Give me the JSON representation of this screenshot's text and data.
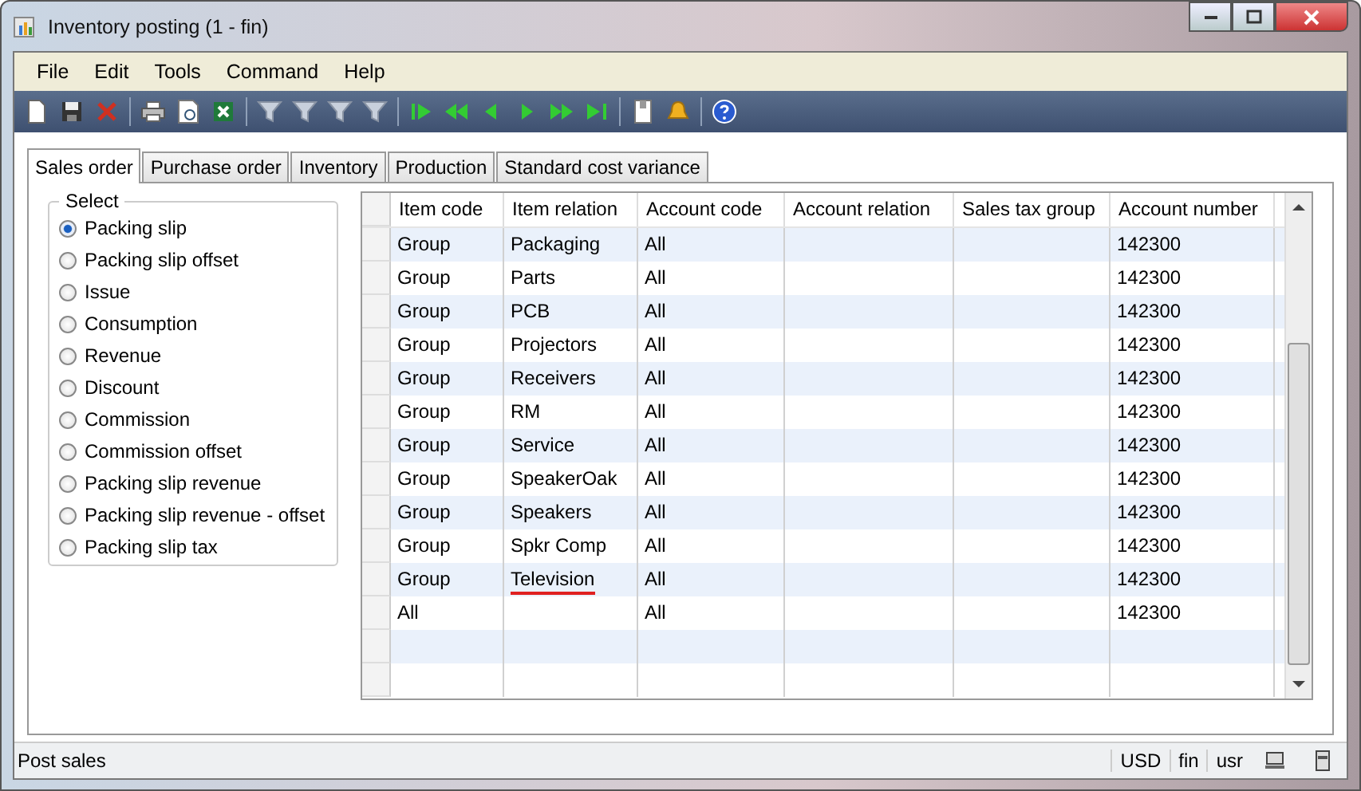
{
  "window": {
    "title": "Inventory posting (1 - fin)"
  },
  "menu": [
    "File",
    "Edit",
    "Tools",
    "Command",
    "Help"
  ],
  "toolbar": [
    {
      "kind": "new"
    },
    {
      "kind": "save"
    },
    {
      "kind": "delete"
    },
    {
      "kind": "sep"
    },
    {
      "kind": "print"
    },
    {
      "kind": "preview"
    },
    {
      "kind": "excel"
    },
    {
      "kind": "sep"
    },
    {
      "kind": "filter"
    },
    {
      "kind": "filter"
    },
    {
      "kind": "filter"
    },
    {
      "kind": "filter"
    },
    {
      "kind": "sep"
    },
    {
      "kind": "first"
    },
    {
      "kind": "prev-page"
    },
    {
      "kind": "prev"
    },
    {
      "kind": "next"
    },
    {
      "kind": "next-page"
    },
    {
      "kind": "last"
    },
    {
      "kind": "sep"
    },
    {
      "kind": "document"
    },
    {
      "kind": "alert"
    },
    {
      "kind": "sep"
    },
    {
      "kind": "help"
    }
  ],
  "tabs": [
    {
      "label": "Sales order",
      "selected": true
    },
    {
      "label": "Purchase order",
      "selected": false
    },
    {
      "label": "Inventory",
      "selected": false
    },
    {
      "label": "Production",
      "selected": false
    },
    {
      "label": "Standard cost variance",
      "selected": false
    }
  ],
  "select": {
    "title": "Select",
    "options": [
      {
        "label": "Packing slip",
        "selected": true
      },
      {
        "label": "Packing slip offset",
        "selected": false
      },
      {
        "label": "Issue",
        "selected": false
      },
      {
        "label": "Consumption",
        "selected": false
      },
      {
        "label": "Revenue",
        "selected": false
      },
      {
        "label": "Discount",
        "selected": false
      },
      {
        "label": "Commission",
        "selected": false
      },
      {
        "label": "Commission offset",
        "selected": false
      },
      {
        "label": "Packing slip revenue",
        "selected": false
      },
      {
        "label": "Packing slip revenue - offset",
        "selected": false
      },
      {
        "label": "Packing slip tax",
        "selected": false
      }
    ]
  },
  "table": {
    "columns": [
      "Item code",
      "Item relation",
      "Account code",
      "Account relation",
      "Sales tax group",
      "Account number"
    ],
    "rows": [
      {
        "cells": [
          "Group",
          "Packaging",
          "All",
          "",
          "",
          "142300"
        ],
        "underlined": false
      },
      {
        "cells": [
          "Group",
          "Parts",
          "All",
          "",
          "",
          "142300"
        ],
        "underlined": false
      },
      {
        "cells": [
          "Group",
          "PCB",
          "All",
          "",
          "",
          "142300"
        ],
        "underlined": false
      },
      {
        "cells": [
          "Group",
          "Projectors",
          "All",
          "",
          "",
          "142300"
        ],
        "underlined": false
      },
      {
        "cells": [
          "Group",
          "Receivers",
          "All",
          "",
          "",
          "142300"
        ],
        "underlined": false
      },
      {
        "cells": [
          "Group",
          "RM",
          "All",
          "",
          "",
          "142300"
        ],
        "underlined": false
      },
      {
        "cells": [
          "Group",
          "Service",
          "All",
          "",
          "",
          "142300"
        ],
        "underlined": false
      },
      {
        "cells": [
          "Group",
          "SpeakerOak",
          "All",
          "",
          "",
          "142300"
        ],
        "underlined": false
      },
      {
        "cells": [
          "Group",
          "Speakers",
          "All",
          "",
          "",
          "142300"
        ],
        "underlined": false
      },
      {
        "cells": [
          "Group",
          "Spkr Comp",
          "All",
          "",
          "",
          "142300"
        ],
        "underlined": false
      },
      {
        "cells": [
          "Group",
          "Television",
          "All",
          "",
          "",
          "142300"
        ],
        "underlined": true
      },
      {
        "cells": [
          "All",
          "",
          "All",
          "",
          "",
          "142300"
        ],
        "underlined": false
      }
    ]
  },
  "status_bar": {
    "message": "Post sales",
    "currency": "USD",
    "company": "fin",
    "user": "usr"
  }
}
